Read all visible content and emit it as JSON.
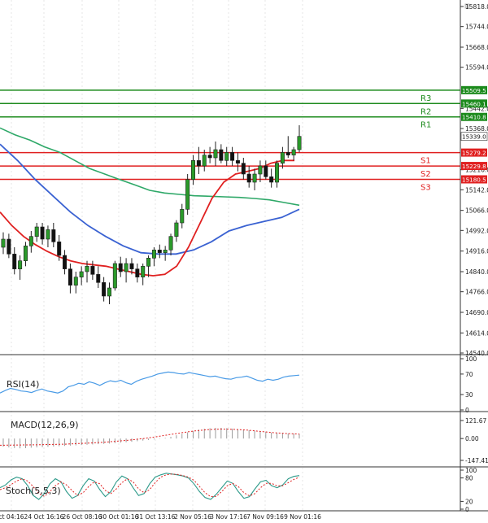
{
  "chart_data": [
    {
      "type": "candlestick",
      "panel": "price",
      "y_ticks": [
        "15818.0",
        "15744.0",
        "15668.0",
        "15594.0",
        "15442.0",
        "15368.0",
        "15216.0",
        "15142.0",
        "15066.0",
        "14992.0",
        "14916.0",
        "14840.0",
        "14766.0",
        "14690.0",
        "14614.0",
        "14540.0"
      ],
      "ylim": [
        14540,
        15818
      ],
      "x_ticks": [
        "ct 04:16",
        "24 Oct 16:16",
        "26 Oct 08:16",
        "30 Oct 01:16",
        "31 Oct 13:16",
        "2 Nov 05:16",
        "3 Nov 17:16",
        "7 Nov 09:16",
        "9 Nov 01:16"
      ],
      "levels": [
        {
          "name": "R3",
          "value": 15509.5,
          "label": "15509.5",
          "color": "#1b8a1b"
        },
        {
          "name": "R2",
          "value": 15460.1,
          "label": "15460.1",
          "color": "#1b8a1b"
        },
        {
          "name": "R1",
          "value": 15410.8,
          "label": "15410.8",
          "color": "#1b8a1b"
        },
        {
          "name": "S1",
          "value": 15279.2,
          "label": "15279.2",
          "color": "#e02020"
        },
        {
          "name": "S2",
          "value": 15229.8,
          "label": "15229.8",
          "color": "#e02020"
        },
        {
          "name": "S3",
          "value": 15180.5,
          "label": "15180.5",
          "color": "#e02020"
        }
      ],
      "last_price": {
        "value": 15339.0,
        "label": "15339.0"
      },
      "candles": [
        {
          "o": 14930,
          "h": 14985,
          "l": 14905,
          "c": 14960
        },
        {
          "o": 14960,
          "h": 14980,
          "l": 14890,
          "c": 14905
        },
        {
          "o": 14905,
          "h": 14930,
          "l": 14830,
          "c": 14850
        },
        {
          "o": 14850,
          "h": 14900,
          "l": 14810,
          "c": 14880
        },
        {
          "o": 14880,
          "h": 14950,
          "l": 14860,
          "c": 14935
        },
        {
          "o": 14935,
          "h": 14990,
          "l": 14910,
          "c": 14970
        },
        {
          "o": 14970,
          "h": 15020,
          "l": 14950,
          "c": 15005
        },
        {
          "o": 15005,
          "h": 15020,
          "l": 14940,
          "c": 14960
        },
        {
          "o": 14960,
          "h": 15010,
          "l": 14930,
          "c": 14995
        },
        {
          "o": 14995,
          "h": 15020,
          "l": 14930,
          "c": 14950
        },
        {
          "o": 14950,
          "h": 14975,
          "l": 14880,
          "c": 14900
        },
        {
          "o": 14900,
          "h": 14920,
          "l": 14830,
          "c": 14850
        },
        {
          "o": 14850,
          "h": 14870,
          "l": 14760,
          "c": 14790
        },
        {
          "o": 14790,
          "h": 14840,
          "l": 14760,
          "c": 14820
        },
        {
          "o": 14820,
          "h": 14860,
          "l": 14790,
          "c": 14840
        },
        {
          "o": 14840,
          "h": 14880,
          "l": 14800,
          "c": 14860
        },
        {
          "o": 14860,
          "h": 14880,
          "l": 14810,
          "c": 14830
        },
        {
          "o": 14830,
          "h": 14860,
          "l": 14780,
          "c": 14800
        },
        {
          "o": 14800,
          "h": 14820,
          "l": 14730,
          "c": 14750
        },
        {
          "o": 14750,
          "h": 14800,
          "l": 14720,
          "c": 14780
        },
        {
          "o": 14780,
          "h": 14880,
          "l": 14770,
          "c": 14870
        },
        {
          "o": 14870,
          "h": 14895,
          "l": 14820,
          "c": 14840
        },
        {
          "o": 14840,
          "h": 14890,
          "l": 14800,
          "c": 14870
        },
        {
          "o": 14870,
          "h": 14890,
          "l": 14830,
          "c": 14850
        },
        {
          "o": 14850,
          "h": 14870,
          "l": 14800,
          "c": 14820
        },
        {
          "o": 14820,
          "h": 14870,
          "l": 14790,
          "c": 14860
        },
        {
          "o": 14860,
          "h": 14900,
          "l": 14820,
          "c": 14890
        },
        {
          "o": 14890,
          "h": 14930,
          "l": 14860,
          "c": 14920
        },
        {
          "o": 14920,
          "h": 14940,
          "l": 14890,
          "c": 14910
        },
        {
          "o": 14910,
          "h": 14935,
          "l": 14880,
          "c": 14920
        },
        {
          "o": 14920,
          "h": 14980,
          "l": 14900,
          "c": 14970
        },
        {
          "o": 14970,
          "h": 15030,
          "l": 14950,
          "c": 15020
        },
        {
          "o": 15020,
          "h": 15090,
          "l": 15000,
          "c": 15070
        },
        {
          "o": 15070,
          "h": 15200,
          "l": 15050,
          "c": 15180
        },
        {
          "o": 15180,
          "h": 15270,
          "l": 15160,
          "c": 15250
        },
        {
          "o": 15250,
          "h": 15300,
          "l": 15200,
          "c": 15230
        },
        {
          "o": 15230,
          "h": 15290,
          "l": 15210,
          "c": 15270
        },
        {
          "o": 15270,
          "h": 15300,
          "l": 15240,
          "c": 15260
        },
        {
          "o": 15260,
          "h": 15320,
          "l": 15230,
          "c": 15290
        },
        {
          "o": 15290,
          "h": 15310,
          "l": 15240,
          "c": 15250
        },
        {
          "o": 15250,
          "h": 15300,
          "l": 15230,
          "c": 15280
        },
        {
          "o": 15280,
          "h": 15300,
          "l": 15230,
          "c": 15250
        },
        {
          "o": 15250,
          "h": 15280,
          "l": 15210,
          "c": 15240
        },
        {
          "o": 15240,
          "h": 15260,
          "l": 15180,
          "c": 15200
        },
        {
          "o": 15200,
          "h": 15230,
          "l": 15150,
          "c": 15170
        },
        {
          "o": 15170,
          "h": 15220,
          "l": 15140,
          "c": 15200
        },
        {
          "o": 15200,
          "h": 15250,
          "l": 15170,
          "c": 15230
        },
        {
          "o": 15230,
          "h": 15250,
          "l": 15180,
          "c": 15190
        },
        {
          "o": 15190,
          "h": 15220,
          "l": 15150,
          "c": 15170
        },
        {
          "o": 15170,
          "h": 15250,
          "l": 15150,
          "c": 15240
        },
        {
          "o": 15240,
          "h": 15300,
          "l": 15220,
          "c": 15280
        },
        {
          "o": 15280,
          "h": 15340,
          "l": 15260,
          "c": 15270
        },
        {
          "o": 15270,
          "h": 15300,
          "l": 15250,
          "c": 15290
        },
        {
          "o": 15290,
          "h": 15380,
          "l": 15280,
          "c": 15339
        }
      ],
      "ma_fast": {
        "color": "#e02020",
        "values": [
          15060,
          15010,
          14970,
          14940,
          14915,
          14895,
          14880,
          14870,
          14865,
          14860,
          14850,
          14840,
          14830,
          14825,
          14830,
          14860,
          14930,
          15020,
          15110,
          15170,
          15200,
          15210,
          15220,
          15240,
          15250,
          15250
        ]
      },
      "ma_mid": {
        "color": "#2ea868",
        "values": [
          15370,
          15345,
          15325,
          15300,
          15280,
          15250,
          15220,
          15200,
          15180,
          15160,
          15140,
          15130,
          15125,
          15120,
          15118,
          15116,
          15114,
          15110,
          15105,
          15095,
          15085
        ]
      },
      "ma_slow": {
        "color": "#3a62d2",
        "values": [
          15310,
          15250,
          15180,
          15120,
          15060,
          15010,
          14970,
          14935,
          14910,
          14905,
          14905,
          14920,
          14950,
          14990,
          15010,
          15025,
          15040,
          15070
        ]
      }
    },
    {
      "type": "line",
      "panel": "rsi",
      "label": "RSI(14)",
      "y_ticks": [
        "100",
        "70",
        "30",
        "0"
      ],
      "ylim": [
        0,
        100
      ],
      "color": "#4a9be6",
      "values": [
        33,
        38,
        42,
        40,
        37,
        36,
        34,
        38,
        41,
        37,
        35,
        33,
        37,
        45,
        48,
        52,
        50,
        55,
        52,
        48,
        53,
        57,
        55,
        58,
        53,
        50,
        56,
        60,
        63,
        66,
        70,
        72,
        74,
        73,
        71,
        70,
        73,
        71,
        69,
        67,
        65,
        66,
        63,
        61,
        60,
        63,
        64,
        66,
        62,
        58,
        56,
        60,
        58,
        60,
        64,
        66,
        67,
        68
      ]
    },
    {
      "type": "bar",
      "panel": "macd",
      "label": "MACD(12,26,9)",
      "y_ticks": [
        "121.67",
        "0.00",
        "-147.41"
      ],
      "ylim": [
        -147.41,
        121.67
      ],
      "bar_color": "#9a9a9a",
      "signal_color": "#e02020",
      "histogram": [
        -55,
        -60,
        -64,
        -66,
        -65,
        -62,
        -60,
        -58,
        -56,
        -54,
        -52,
        -50,
        -48,
        -46,
        -44,
        -42,
        -40,
        -38,
        -36,
        -34,
        -31,
        -28,
        -25,
        -22,
        -18,
        -14,
        -10,
        -6,
        -2,
        4,
        12,
        22,
        32,
        42,
        52,
        60,
        66,
        70,
        72,
        72,
        70,
        67,
        64,
        60,
        56,
        52,
        48,
        44,
        40,
        38,
        36,
        34,
        33,
        32
      ],
      "signal": [
        -45,
        -44,
        -43,
        -42,
        -40,
        -38,
        -34,
        -30,
        -25,
        -18,
        -10,
        0,
        12,
        26,
        40,
        52,
        60,
        64,
        62,
        57,
        48,
        40,
        34,
        30
      ]
    },
    {
      "type": "line",
      "panel": "stoch",
      "label": "Stoch(5,5,3)",
      "y_ticks": [
        "100",
        "80",
        "20",
        "0"
      ],
      "ylim": [
        0,
        100
      ],
      "k_color": "#2d9a8a",
      "d_color": "#e02020",
      "k": [
        55,
        62,
        75,
        82,
        78,
        60,
        35,
        25,
        40,
        65,
        78,
        70,
        45,
        28,
        35,
        60,
        78,
        72,
        50,
        32,
        45,
        70,
        85,
        78,
        55,
        35,
        40,
        65,
        82,
        88,
        92,
        90,
        88,
        85,
        80,
        65,
        45,
        30,
        25,
        38,
        55,
        72,
        66,
        45,
        28,
        32,
        52,
        70,
        74,
        60,
        55,
        62,
        78,
        84,
        86
      ],
      "d": [
        50,
        55,
        63,
        72,
        78,
        72,
        58,
        40,
        33,
        45,
        60,
        70,
        62,
        48,
        35,
        42,
        58,
        70,
        65,
        48,
        40,
        52,
        68,
        78,
        70,
        52,
        42,
        50,
        68,
        82,
        88,
        90,
        89,
        86,
        82,
        74,
        58,
        42,
        32,
        33,
        45,
        60,
        66,
        58,
        42,
        34,
        40,
        55,
        66,
        66,
        60,
        60,
        68,
        76,
        82
      ]
    }
  ]
}
